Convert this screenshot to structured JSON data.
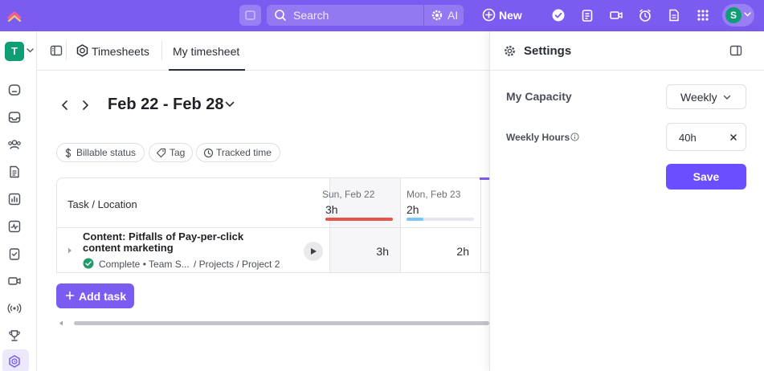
{
  "topbar": {
    "search_placeholder": "Search",
    "ai_label": "AI",
    "new_label": "New",
    "avatar_initial": "S"
  },
  "workspace": {
    "initial": "T"
  },
  "header": {
    "timesheets_label": "Timesheets",
    "my_timesheet_label": "My timesheet"
  },
  "date_range": "Feb 22 - Feb 28",
  "filters": [
    {
      "label": "Billable status",
      "icon": "dollar-icon"
    },
    {
      "label": "Tag",
      "icon": "tag-icon"
    },
    {
      "label": "Tracked time",
      "icon": "clock-icon"
    }
  ],
  "table": {
    "task_header": "Task / Location",
    "days": [
      {
        "name": "Sun, Feb 22",
        "total": "3h",
        "bar_color": "#e5534b",
        "bar_fill": 1.0
      },
      {
        "name": "Mon, Feb 23",
        "total": "2h",
        "bar_color": "#7cc4f8",
        "bar_fill": 0.25
      }
    ],
    "rows": [
      {
        "title": "Content: Pitfalls of Pay-per-click content marketing",
        "status": "Complete",
        "team": "Team S...",
        "path": "/ Projects / Project 2",
        "cells": [
          "3h",
          "2h"
        ]
      }
    ]
  },
  "add_task_label": "Add task",
  "settings": {
    "title": "Settings",
    "capacity_label": "My Capacity",
    "capacity_value": "Weekly",
    "hours_label": "Weekly Hours",
    "hours_value": "40h",
    "save_label": "Save"
  },
  "colors": {
    "brand": "#7b5cf0",
    "save": "#6b4eff",
    "workspace": "#0f9d76",
    "complete": "#1f9b6b"
  }
}
